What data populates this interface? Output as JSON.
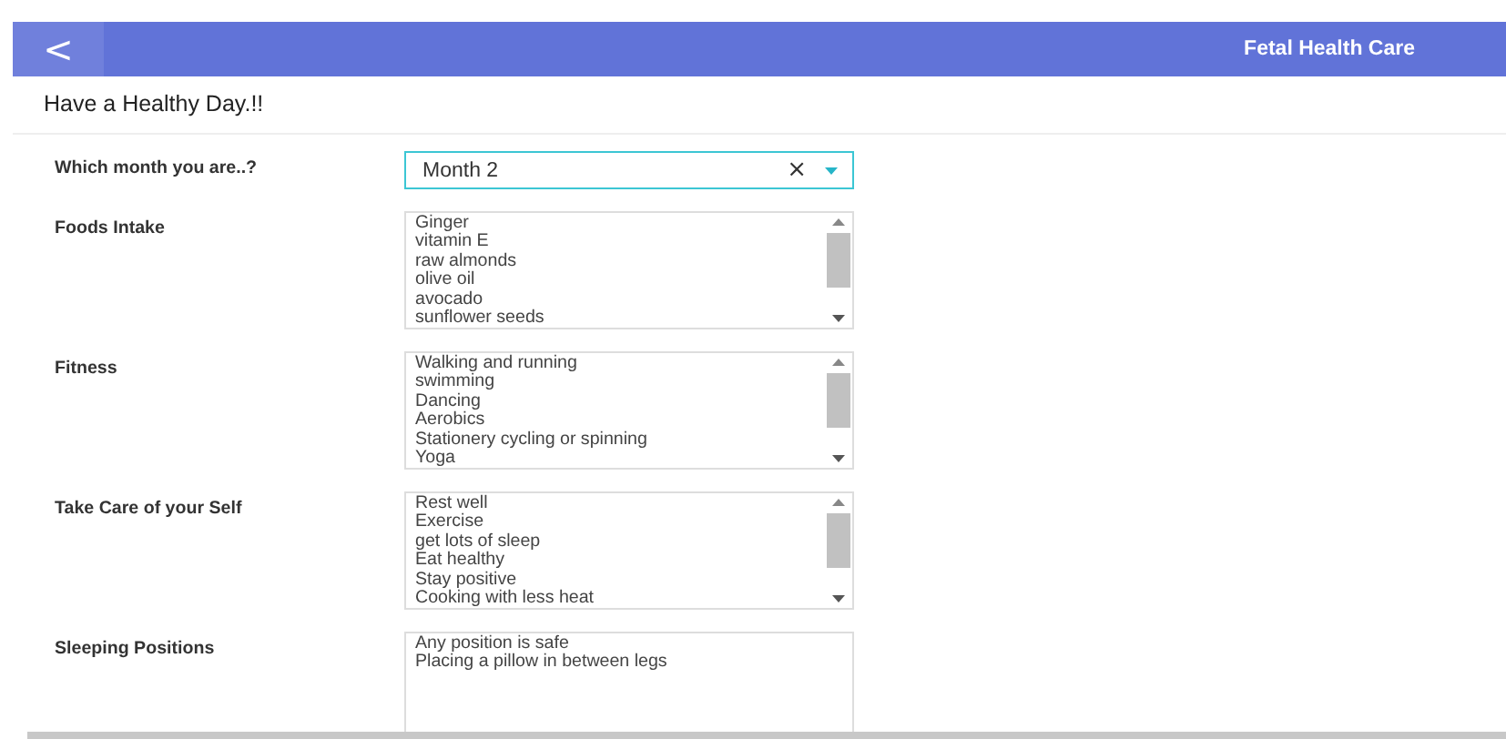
{
  "header": {
    "back": "<",
    "title": "Fetal Health Care"
  },
  "heading": "Have a Healthy Day.!!",
  "month": {
    "label": "Which month you are..?",
    "value": "Month 2",
    "clear": "×"
  },
  "lists": [
    {
      "label": "Foods Intake",
      "scrollable": true,
      "items": [
        "Ginger",
        "vitamin E",
        "raw almonds",
        "olive oil",
        "avocado",
        "sunflower seeds"
      ]
    },
    {
      "label": "Fitness",
      "scrollable": true,
      "items": [
        "Walking and running",
        "swimming",
        "Dancing",
        "Aerobics",
        "Stationery cycling or spinning",
        "Yoga"
      ]
    },
    {
      "label": "Take Care of your Self",
      "scrollable": true,
      "items": [
        "Rest well",
        "Exercise",
        "get lots of sleep",
        "Eat healthy",
        "Stay positive",
        "Cooking with less heat"
      ]
    },
    {
      "label": "Sleeping Positions",
      "scrollable": false,
      "items": [
        "Any position is safe",
        "Placing a pillow in between legs"
      ]
    }
  ]
}
